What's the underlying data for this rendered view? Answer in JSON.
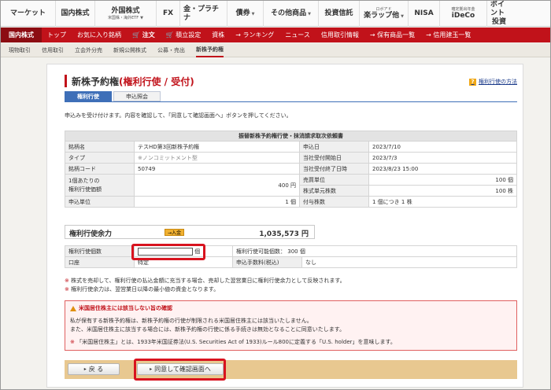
{
  "topnav": [
    {
      "sub": "",
      "main": "マーケット"
    },
    {
      "sub": "",
      "main": "国内株式"
    },
    {
      "sub": "外国株式",
      "main": "米国株・海外ETF",
      "caret": true
    },
    {
      "sub": "",
      "main": "FX"
    },
    {
      "sub": "",
      "main": "金・プラチナ"
    },
    {
      "sub": "",
      "main": "債券",
      "caret": true
    },
    {
      "sub": "",
      "main": "その他商品",
      "caret": true
    },
    {
      "sub": "",
      "main": "投資信託"
    },
    {
      "sub": "ロボアド",
      "main": "楽ラップ他",
      "caret": true
    },
    {
      "sub": "",
      "main": "NISA"
    },
    {
      "sub": "確定拠出年金",
      "main": "iDeCo"
    },
    {
      "sub": "ポイント",
      "main": "投資"
    }
  ],
  "redbar": {
    "section": "国内株式",
    "items": [
      "トップ",
      "お気に入り銘柄",
      "注文",
      "積立設定",
      "資株",
      "→ ランキング",
      "ニュース",
      "信用取引情報",
      "→ 保有商品一覧",
      "→ 信用建玉一覧"
    ]
  },
  "subnav": [
    "現物取引",
    "信用取引",
    "立会外分売",
    "新規公開株式",
    "公募・売出",
    "新株予約権"
  ],
  "page": {
    "title_black": "新株予約権",
    "title_red": "(権利行使 / 受付)",
    "help": "権利行使の方法",
    "help_q": "?",
    "tabs": [
      "権利行使",
      "申込照会"
    ],
    "intro": "申込みを受け付けます。内容を確認して、「同意して確認画面へ」ボタンを押してください。"
  },
  "info_table": {
    "caption": "振替新株予約権行使・抹消請求取次依頼書",
    "rows": [
      {
        "l1": "銘柄名",
        "v1": "テスHD第3回新株予約権",
        "l2": "申込日",
        "v2": "2023/7/10"
      },
      {
        "l1": "タイプ",
        "v1": "※ノンコミットメント型",
        "l2": "当社受付開始日",
        "v2": "2023/7/3"
      },
      {
        "l1": "銘柄コード",
        "v1": "50749",
        "l2": "当社受付終了日時",
        "v2": "2023/8/23 15:00"
      },
      {
        "l1": "1個あたりの",
        "l1b": "権利行使価額",
        "v1": "400 円",
        "l2": "売買単位",
        "v2": "100 個",
        "l3": "株式単元株数",
        "v3": "100 株"
      },
      {
        "l1": "申込単位",
        "v1": "1 個",
        "l2": "付与株数",
        "v2": "1 個につき 1 株"
      }
    ]
  },
  "balance": {
    "label": "権利行使余力",
    "button": "→入金",
    "amount": "1,035,573 円"
  },
  "order": {
    "qty_label": "権利行使個数",
    "qty_value": "",
    "qty_unit": "個",
    "max_label": "権利行使可能個数：",
    "max_value": "300 個",
    "account_label": "口座",
    "account_value": "特定",
    "fee_label": "申込手数料(税込)",
    "fee_value": "なし"
  },
  "notes": [
    "株式を売却して、権利行使の払込金額に充当する場合、売却した翌営業日に権利行使余力として反映されます。",
    "権利行使余力は、翌営業日以降の最小値の資金となります。"
  ],
  "warning": {
    "title": "米国居住株主には該当しない旨の確認",
    "line1": "私が保有する新株予約権は、新株予約権の行使が制限される米国居住株主には該当いたしません。",
    "line2": "また、米国居住株主に該当する場合には、新株予約権の行使に係る手続きは無効となることに同意いたします。",
    "line3": "「米国居住株主」とは、1933年米国証券法(U.S. Securities Act of 1933)ルール800に定義する「U.S. holder」を意味します。"
  },
  "buttons": {
    "back": "戻 る",
    "confirm": "同意して確認画面へ"
  },
  "colors": {
    "brand_red": "#c1121a",
    "tab_blue": "#3e6fb8",
    "highlight": "#d8131f"
  }
}
